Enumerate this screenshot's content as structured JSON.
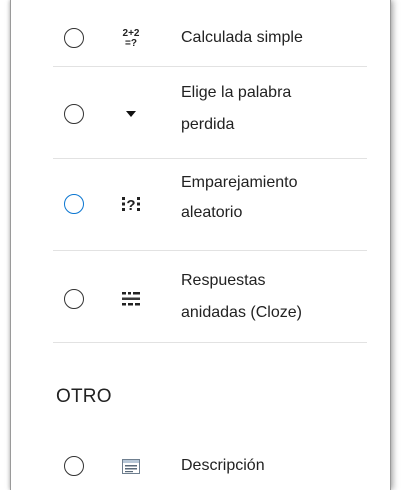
{
  "options": [
    {
      "label_lines": [
        "Calculada simple"
      ],
      "icon": "calculated-simple-icon",
      "focused": false
    },
    {
      "label_lines": [
        "Elige la palabra",
        "perdida"
      ],
      "icon": "dropdown-arrow-icon",
      "focused": false
    },
    {
      "label_lines": [
        "Emparejamiento",
        "aleatorio"
      ],
      "icon": "random-matching-icon",
      "focused": true
    },
    {
      "label_lines": [
        "Respuestas",
        "anidadas (Cloze)"
      ],
      "icon": "cloze-icon",
      "focused": false
    }
  ],
  "section_other": {
    "title": "OTRO",
    "options": [
      {
        "label_lines": [
          "Descripción"
        ],
        "icon": "description-icon",
        "focused": false
      }
    ]
  },
  "icons": {
    "calculated_text_top": "2+2",
    "calculated_text_bottom": "=?",
    "random_matching_text": "?"
  },
  "colors": {
    "focus_ring": "#0b76d1",
    "text": "#222222",
    "separator": "#e2e2e2"
  }
}
